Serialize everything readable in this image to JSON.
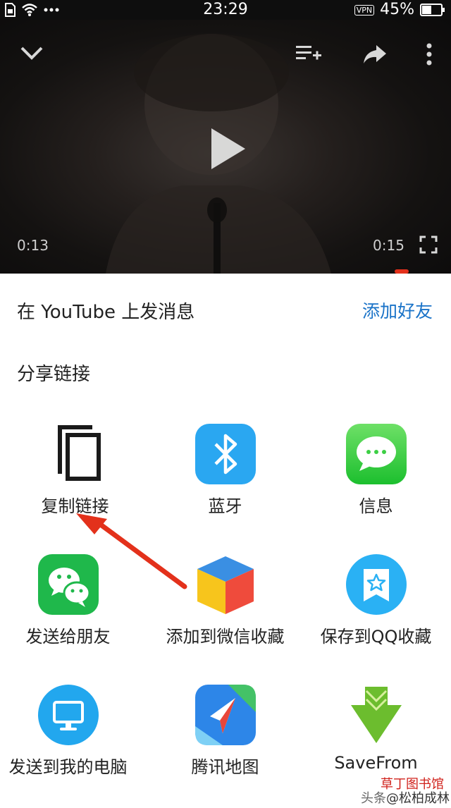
{
  "status_bar": {
    "time": "23:29",
    "vpn": "VPN",
    "battery": "45%"
  },
  "video": {
    "time_elapsed": "0:13",
    "time_total": "0:15",
    "accent_color": "#e3311b"
  },
  "share_sheet": {
    "message_title": "在 YouTube 上发消息",
    "add_friend": "添加好友",
    "share_link_title": "分享链接",
    "items": [
      {
        "label": "复制链接",
        "icon": "copy-icon"
      },
      {
        "label": "蓝牙",
        "icon": "bluetooth-icon"
      },
      {
        "label": "信息",
        "icon": "messages-icon"
      },
      {
        "label": "发送给朋友",
        "icon": "wechat-icon"
      },
      {
        "label": "添加到微信收藏",
        "icon": "wechat-favorites-icon"
      },
      {
        "label": "保存到QQ收藏",
        "icon": "qq-favorites-icon"
      },
      {
        "label": "发送到我的电脑",
        "icon": "computer-icon"
      },
      {
        "label": "腾讯地图",
        "icon": "tencent-map-icon"
      },
      {
        "label": "SaveFrom",
        "icon": "savefrom-icon"
      }
    ]
  },
  "watermark": {
    "source": "头条",
    "author": "@松柏成林",
    "overlay": "草丁图书馆"
  }
}
